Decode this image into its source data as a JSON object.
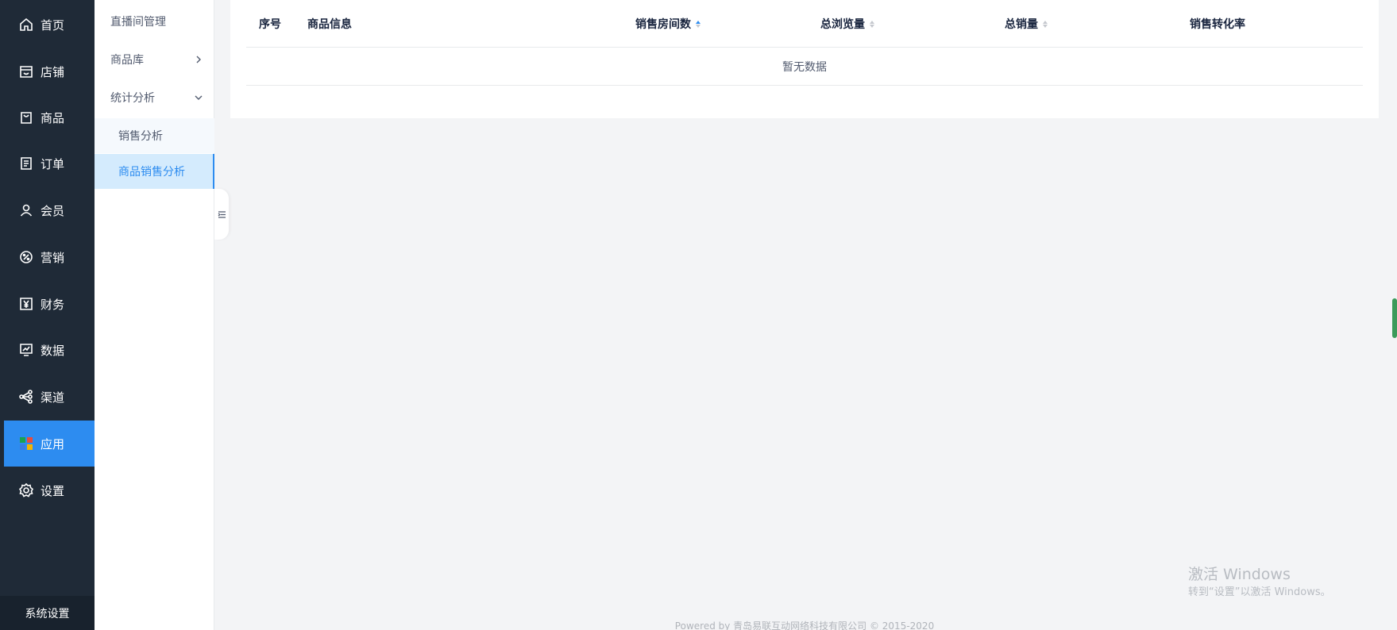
{
  "main_nav": {
    "items": [
      {
        "label": "首页",
        "icon": "home-icon"
      },
      {
        "label": "店铺",
        "icon": "store-icon"
      },
      {
        "label": "商品",
        "icon": "shopping-bag-icon"
      },
      {
        "label": "订单",
        "icon": "order-icon"
      },
      {
        "label": "会员",
        "icon": "user-icon"
      },
      {
        "label": "营销",
        "icon": "marketing-icon"
      },
      {
        "label": "财务",
        "icon": "yen-icon"
      },
      {
        "label": "数据",
        "icon": "chart-icon"
      },
      {
        "label": "渠道",
        "icon": "share-icon"
      },
      {
        "label": "应用",
        "icon": "app-grid-icon",
        "active": true
      },
      {
        "label": "设置",
        "icon": "gear-icon"
      }
    ],
    "system_settings": "系统设置",
    "active_color": "#2d8cf0"
  },
  "sub_nav": {
    "items": [
      {
        "label": "直播间管理"
      },
      {
        "label": "商品库",
        "chevron": "right"
      },
      {
        "label": "统计分析",
        "chevron": "down",
        "expanded": true
      }
    ],
    "children": [
      {
        "label": "销售分析"
      },
      {
        "label": "商品销售分析",
        "active": true
      }
    ]
  },
  "table": {
    "columns": [
      {
        "label": "序号"
      },
      {
        "label": "商品信息"
      },
      {
        "label": "销售房间数",
        "sortable": true,
        "sort": "asc"
      },
      {
        "label": "总浏览量",
        "sortable": true
      },
      {
        "label": "总销量",
        "sortable": true
      },
      {
        "label": "销售转化率"
      }
    ],
    "empty_text": "暂无数据"
  },
  "watermark": {
    "line1": "激活 Windows",
    "line2": "转到“设置”以激活 Windows。"
  },
  "footer": "Powered by 青岛易联互动网络科技有限公司 © 2015-2020"
}
